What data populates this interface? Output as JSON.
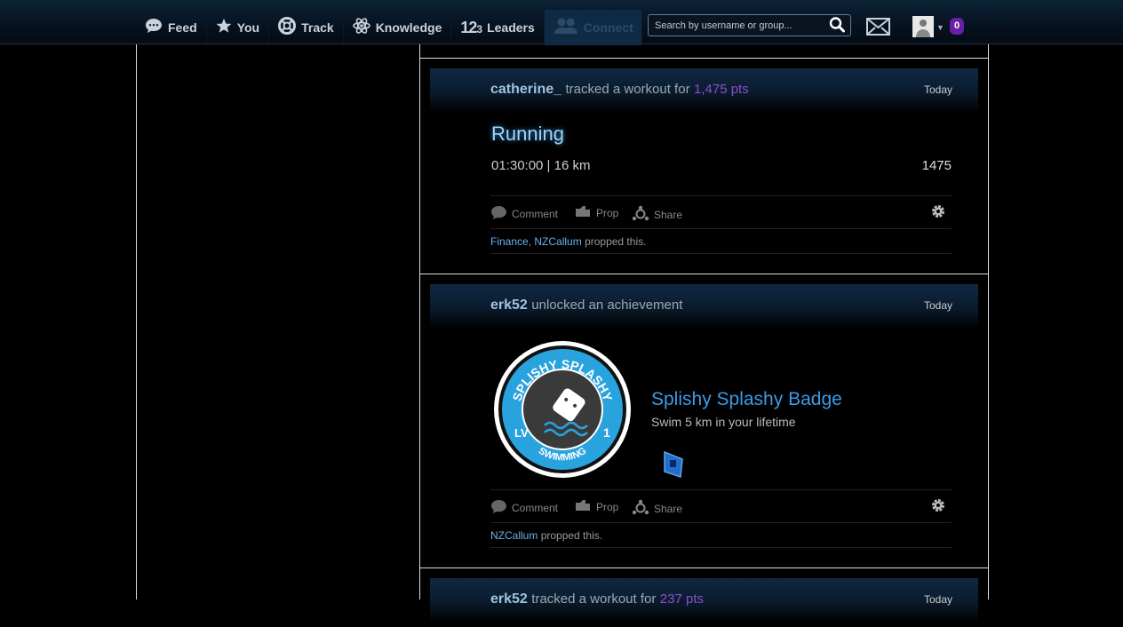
{
  "nav": {
    "items": [
      {
        "label": "Feed",
        "icon": "speech-bubble-icon"
      },
      {
        "label": "You",
        "icon": "star-icon"
      },
      {
        "label": "Track",
        "icon": "lifebuoy-icon"
      },
      {
        "label": "Knowledge",
        "icon": "atom-icon"
      },
      {
        "label": "Leaders",
        "icon": "123-icon"
      },
      {
        "label": "Connect",
        "icon": "people-icon"
      }
    ],
    "search_placeholder": "Search by username or group...",
    "notification_count": "0"
  },
  "posts": [
    {
      "username": "catherine_",
      "action": "tracked a workout for",
      "points": "1,475 pts",
      "date": "Today",
      "workout_title": "Running",
      "workout_detail": "01:30:00 | 16 km",
      "workout_score": "1475",
      "comment_label": "Comment",
      "prop_label": "Prop",
      "share_label": "Share",
      "propped_users": [
        "Finance",
        "NZCallum"
      ],
      "propped_suffix": "propped this."
    },
    {
      "username": "erk52",
      "action": "unlocked an achievement",
      "date": "Today",
      "badge_title": "Splishy Splashy Badge",
      "badge_desc": "Swim 5 km in your lifetime",
      "badge_top_text": "SPLISHY SPLASHY",
      "badge_bottom_text": "SWIMMING",
      "badge_level_left": "LV",
      "badge_level_right": "1",
      "comment_label": "Comment",
      "prop_label": "Prop",
      "share_label": "Share",
      "propped_users": [
        "NZCallum"
      ],
      "propped_suffix": "propped this."
    },
    {
      "username": "erk52",
      "action": "tracked a workout for",
      "points": "237 pts",
      "date": "Today"
    }
  ],
  "colors": {
    "accent": "#2d8fd8",
    "points": "#8a4fd0",
    "username": "#9fc3de",
    "badge_blue": "#29a3de"
  }
}
